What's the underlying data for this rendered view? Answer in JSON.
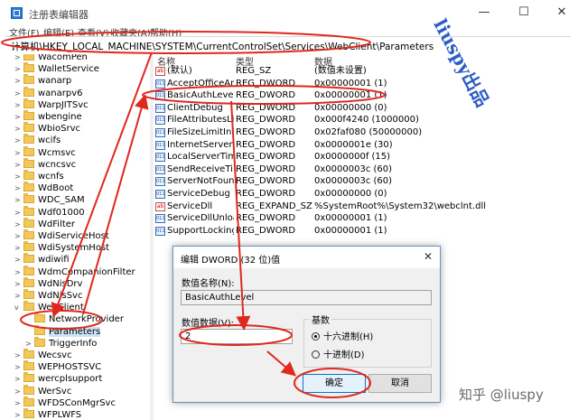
{
  "window": {
    "title": "注册表编辑器",
    "minimize": "—",
    "maximize": "☐",
    "close": "✕"
  },
  "menu": [
    "文件(F)",
    "编辑(E)",
    "查看(V)",
    "收藏夹(A)",
    "帮助(H)"
  ],
  "address": "计算机\\HKEY_LOCAL_MACHINE\\SYSTEM\\CurrentControlSet\\Services\\WebClient\\Parameters",
  "tree": [
    {
      "label": "WacomPen",
      "expander": ">",
      "indent": 0
    },
    {
      "label": "WalletService",
      "expander": ">",
      "indent": 0
    },
    {
      "label": "wanarp",
      "expander": ">",
      "indent": 0
    },
    {
      "label": "wanarpv6",
      "expander": ">",
      "indent": 0
    },
    {
      "label": "WarpJITSvc",
      "expander": ">",
      "indent": 0
    },
    {
      "label": "wbengine",
      "expander": ">",
      "indent": 0
    },
    {
      "label": "WbioSrvc",
      "expander": ">",
      "indent": 0
    },
    {
      "label": "wcifs",
      "expander": ">",
      "indent": 0
    },
    {
      "label": "Wcmsvc",
      "expander": ">",
      "indent": 0
    },
    {
      "label": "wcncsvc",
      "expander": ">",
      "indent": 0
    },
    {
      "label": "wcnfs",
      "expander": ">",
      "indent": 0
    },
    {
      "label": "WdBoot",
      "expander": ">",
      "indent": 0
    },
    {
      "label": "WDC_SAM",
      "expander": ">",
      "indent": 0
    },
    {
      "label": "Wdf01000",
      "expander": ">",
      "indent": 0
    },
    {
      "label": "WdFilter",
      "expander": ">",
      "indent": 0
    },
    {
      "label": "WdiServiceHost",
      "expander": ">",
      "indent": 0
    },
    {
      "label": "WdiSystemHost",
      "expander": ">",
      "indent": 0
    },
    {
      "label": "wdiwifi",
      "expander": ">",
      "indent": 0
    },
    {
      "label": "WdmCompanionFilter",
      "expander": ">",
      "indent": 0
    },
    {
      "label": "WdNisDrv",
      "expander": ">",
      "indent": 0
    },
    {
      "label": "WdNisSvc",
      "expander": ">",
      "indent": 0
    },
    {
      "label": "WebClient",
      "expander": "v",
      "indent": 0
    },
    {
      "label": "NetworkProvider",
      "expander": "",
      "indent": 1
    },
    {
      "label": "Parameters",
      "expander": "",
      "indent": 1,
      "selected": true
    },
    {
      "label": "TriggerInfo",
      "expander": ">",
      "indent": 1
    },
    {
      "label": "Wecsvc",
      "expander": ">",
      "indent": 0
    },
    {
      "label": "WEPHOSTSVC",
      "expander": ">",
      "indent": 0
    },
    {
      "label": "wercplsupport",
      "expander": ">",
      "indent": 0
    },
    {
      "label": "WerSvc",
      "expander": ">",
      "indent": 0
    },
    {
      "label": "WFDSConMgrSvc",
      "expander": ">",
      "indent": 0
    },
    {
      "label": "WFPLWFS",
      "expander": ">",
      "indent": 0
    }
  ],
  "columns": {
    "name": "名称",
    "type": "类型",
    "data": "数据"
  },
  "values": [
    {
      "icon": "ab",
      "name": "(默认)",
      "type": "REG_SZ",
      "data": "(数值未设置)"
    },
    {
      "icon": "bin",
      "name": "AcceptOfficeAn...",
      "type": "REG_DWORD",
      "data": "0x00000001 (1)"
    },
    {
      "icon": "bin",
      "name": "BasicAuthLevel",
      "type": "REG_DWORD",
      "data": "0x00000001 (1)"
    },
    {
      "icon": "bin",
      "name": "ClientDebug",
      "type": "REG_DWORD",
      "data": "0x00000000 (0)"
    },
    {
      "icon": "bin",
      "name": "FileAttributesLi...",
      "type": "REG_DWORD",
      "data": "0x000f4240 (1000000)"
    },
    {
      "icon": "bin",
      "name": "FileSizeLimitInB...",
      "type": "REG_DWORD",
      "data": "0x02faf080 (50000000)"
    },
    {
      "icon": "bin",
      "name": "InternetServerTi...",
      "type": "REG_DWORD",
      "data": "0x0000001e (30)"
    },
    {
      "icon": "bin",
      "name": "LocalServerTim...",
      "type": "REG_DWORD",
      "data": "0x0000000f (15)"
    },
    {
      "icon": "bin",
      "name": "SendReceiveTi...",
      "type": "REG_DWORD",
      "data": "0x0000003c (60)"
    },
    {
      "icon": "bin",
      "name": "ServerNotFoun...",
      "type": "REG_DWORD",
      "data": "0x0000003c (60)"
    },
    {
      "icon": "bin",
      "name": "ServiceDebug",
      "type": "REG_DWORD",
      "data": "0x00000000 (0)"
    },
    {
      "icon": "ab",
      "name": "ServiceDll",
      "type": "REG_EXPAND_SZ",
      "data": "%SystemRoot%\\System32\\webclnt.dll"
    },
    {
      "icon": "bin",
      "name": "ServiceDllUnloa...",
      "type": "REG_DWORD",
      "data": "0x00000001 (1)"
    },
    {
      "icon": "bin",
      "name": "SupportLocking",
      "type": "REG_DWORD",
      "data": "0x00000001 (1)"
    }
  ],
  "dialog": {
    "title": "编辑 DWORD (32 位)值",
    "close": "✕",
    "name_label": "数值名称(N):",
    "name_value": "BasicAuthLevel",
    "data_label": "数值数据(V):",
    "data_value": "2",
    "base_label": "基数",
    "hex_label": "十六进制(H)",
    "dec_label": "十进制(D)",
    "hex_selected": true,
    "ok_label": "确定",
    "cancel_label": "取消"
  },
  "watermarks": {
    "side": "liuspy出品",
    "bottom": "知乎 @liuspy"
  },
  "colors": {
    "annotation": "#e0281e",
    "selection": "#cce4f7",
    "accent": "#0078d7"
  }
}
